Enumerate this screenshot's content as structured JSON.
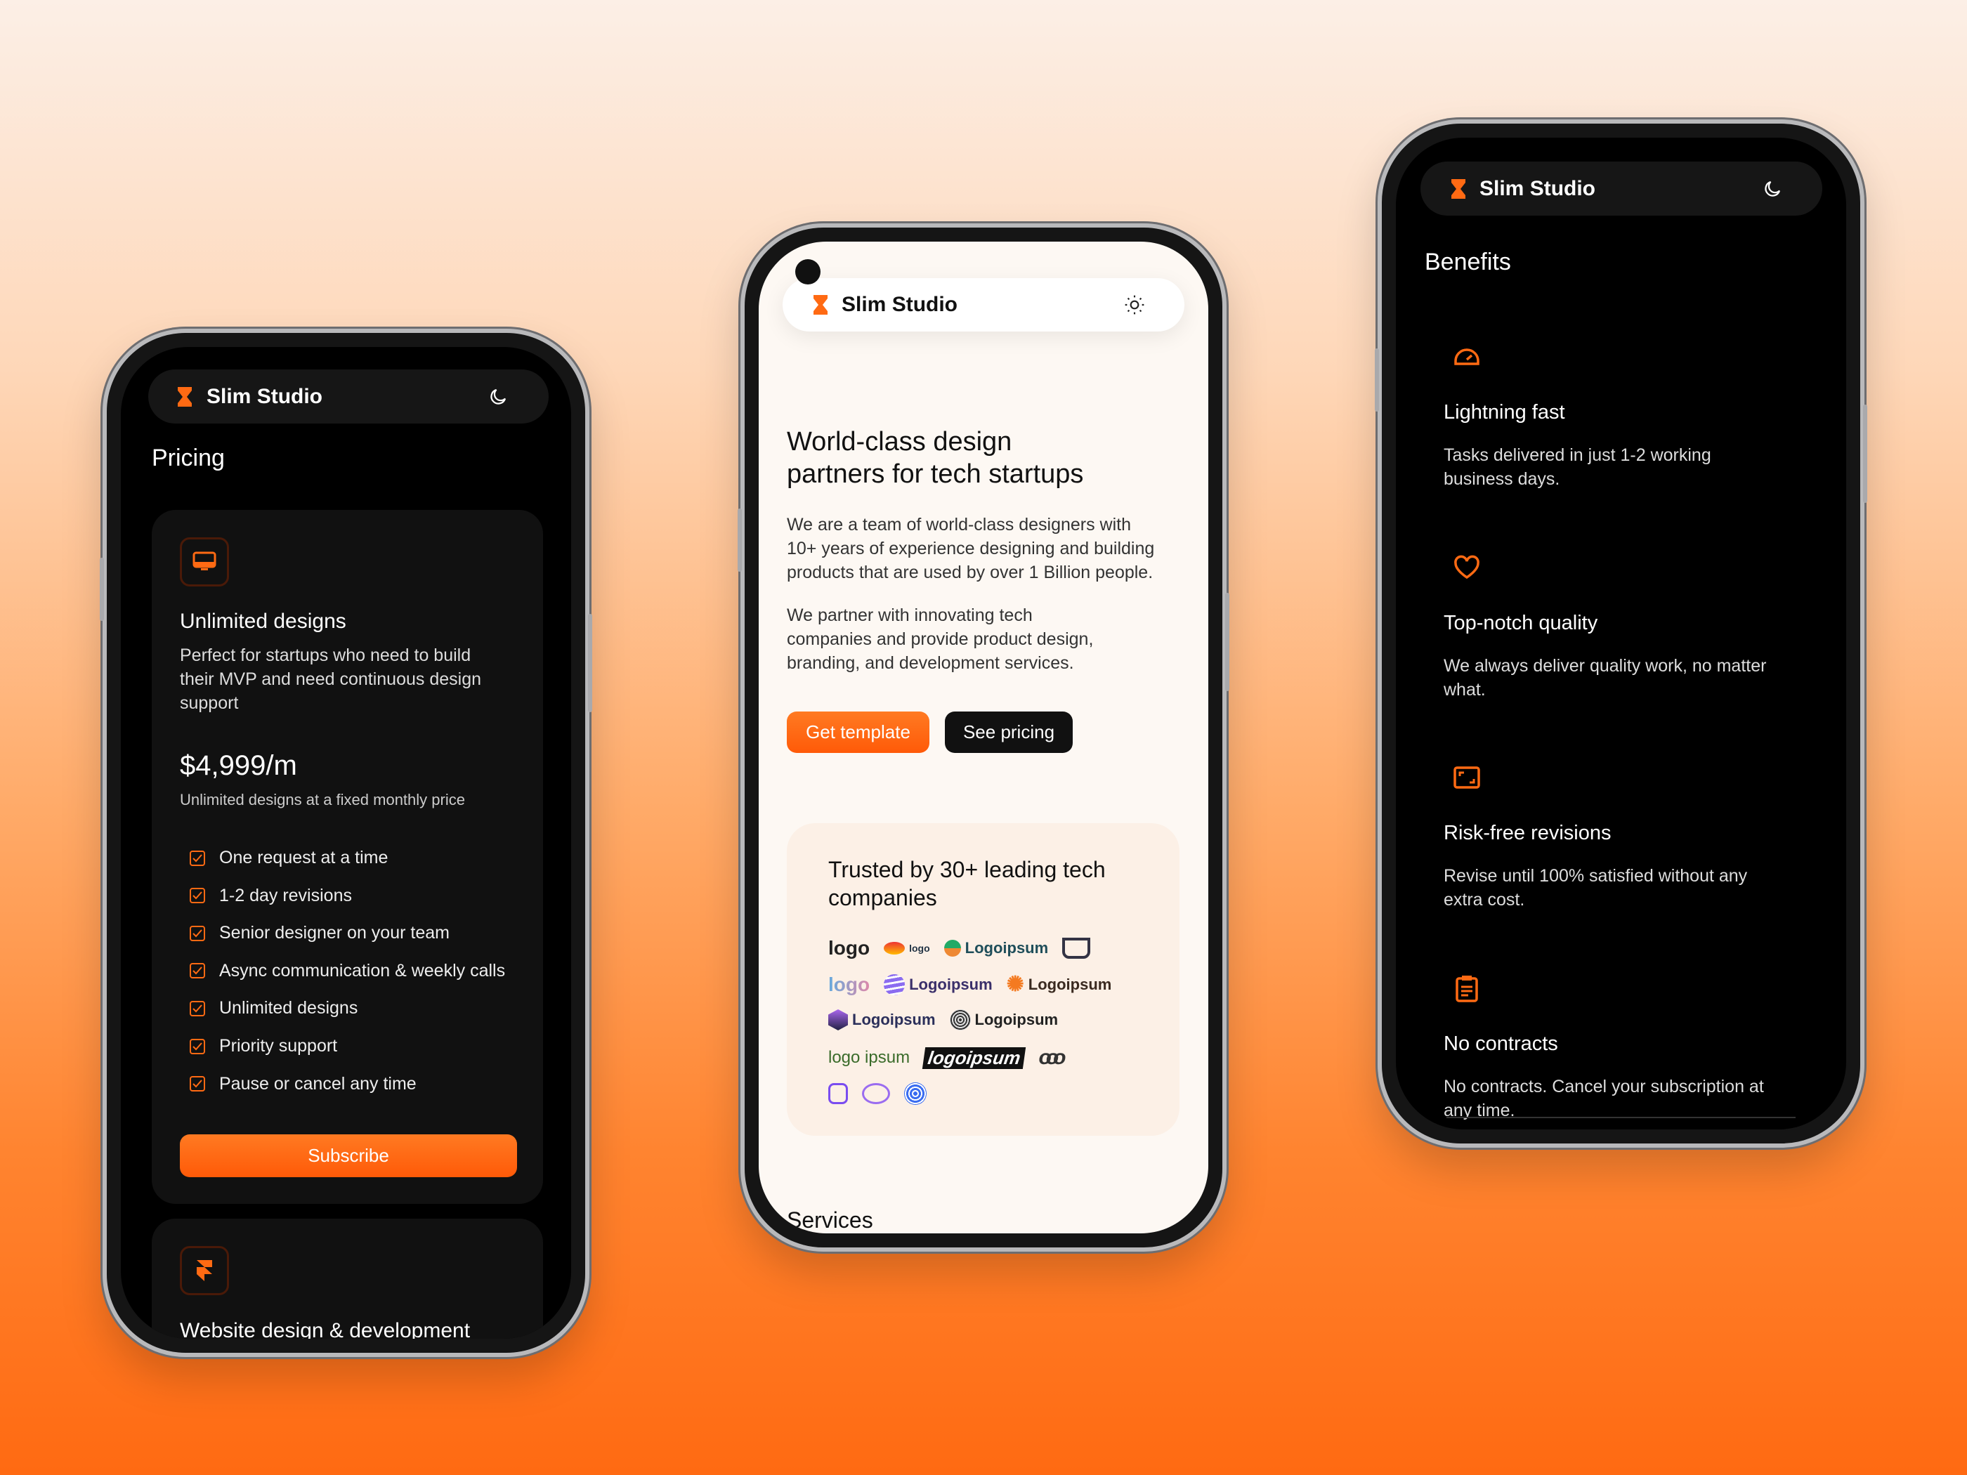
{
  "brand": {
    "name": "Slim Studio",
    "accent": "#ff6a13"
  },
  "left_phone": {
    "theme_icon": "moon-icon",
    "section_title": "Pricing",
    "plan": {
      "icon": "monitor-icon",
      "title": "Unlimited designs",
      "description_lines": [
        "Perfect for startups who need to build",
        "their MVP and need continuous design",
        "support"
      ],
      "price": "$4,999/m",
      "price_note": "Unlimited designs at a fixed monthly price",
      "features": [
        "One request at a time",
        "1-2 day revisions",
        "Senior designer on your team",
        "Async communication & weekly calls",
        "Unlimited designs",
        "Priority support",
        "Pause or cancel any time"
      ],
      "subscribe_label": "Subscribe"
    },
    "plan2": {
      "icon": "framer-icon",
      "title": "Website design & development"
    }
  },
  "middle_phone": {
    "theme_icon": "sun-icon",
    "heading_lines": [
      "World-class design",
      "partners for tech startups"
    ],
    "para1_lines": [
      "We are a team of world-class designers with",
      "10+ years of experience designing and building",
      "products that are used by over 1 Billion people."
    ],
    "para2_lines": [
      "We partner with innovating tech",
      "companies and provide product design,",
      "branding, and development services."
    ],
    "get_template_label": "Get template",
    "see_pricing_label": "See pricing",
    "trusted_lines": [
      "Trusted by 30+ leading tech",
      "companies"
    ],
    "logos": [
      [
        "logo",
        "logo",
        "Logoipsum",
        "logo"
      ],
      [
        "logo",
        "Logoipsum",
        "Logoipsum"
      ],
      [
        "Logoipsum",
        "Logoipsum"
      ],
      [
        "logo ipsum",
        "logoipsum",
        ""
      ],
      [
        "",
        "",
        ""
      ]
    ],
    "services_title": "Services"
  },
  "right_phone": {
    "theme_icon": "moon-icon",
    "section_title": "Benefits",
    "benefits": [
      {
        "icon": "gauge-icon",
        "title": "Lightning fast",
        "lines": [
          "Tasks delivered in just 1-2 working",
          "business days."
        ]
      },
      {
        "icon": "heart-icon",
        "title": "Top-notch quality",
        "lines": [
          "We always deliver quality work, no matter",
          "what."
        ]
      },
      {
        "icon": "frame-corners-icon",
        "title": "Risk-free revisions",
        "lines": [
          "Revise until 100% satisfied without any",
          "extra cost."
        ]
      },
      {
        "icon": "clipboard-icon",
        "title": "No contracts",
        "lines": [
          "No contracts. Cancel your subscription at",
          "any time."
        ]
      }
    ]
  }
}
